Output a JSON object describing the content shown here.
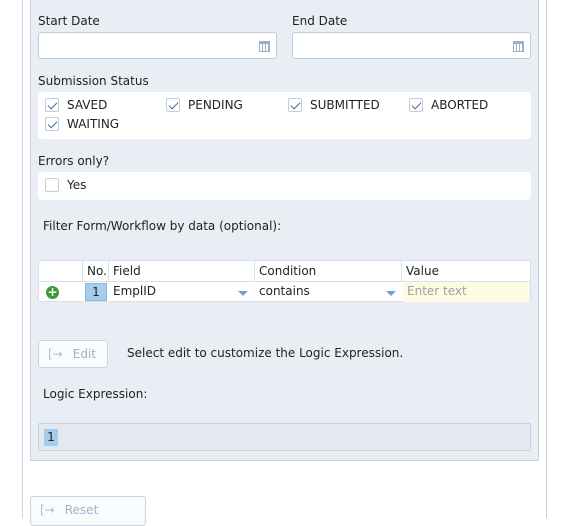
{
  "dates": {
    "start_label": "Start Date",
    "end_label": "End Date",
    "start_value": "",
    "end_value": ""
  },
  "submission_status": {
    "label": "Submission Status",
    "options": [
      {
        "label": "SAVED",
        "checked": true
      },
      {
        "label": "PENDING",
        "checked": true
      },
      {
        "label": "SUBMITTED",
        "checked": true
      },
      {
        "label": "ABORTED",
        "checked": true
      },
      {
        "label": "WAITING",
        "checked": true
      }
    ]
  },
  "errors_only": {
    "label": "Errors only?",
    "option": "Yes",
    "checked": false
  },
  "filter": {
    "label": "Filter Form/Workflow by data (optional):",
    "columns": [
      "No.",
      "Field",
      "Condition",
      "Value"
    ],
    "rows": [
      {
        "no": "1",
        "field": "EmplID",
        "condition": "contains",
        "value_placeholder": "Enter text"
      }
    ]
  },
  "edit": {
    "button_label": "Edit",
    "hint": "Select edit to customize the Logic Expression."
  },
  "logic": {
    "label": "Logic Expression:",
    "tokens": [
      "1"
    ]
  },
  "reset": {
    "button_label": "Reset"
  },
  "colors": {
    "panel_bg": "#e9eef4",
    "accent": "#a6cdf0",
    "add_green": "#3c9a3c",
    "value_bg": "#fdfbe3"
  }
}
